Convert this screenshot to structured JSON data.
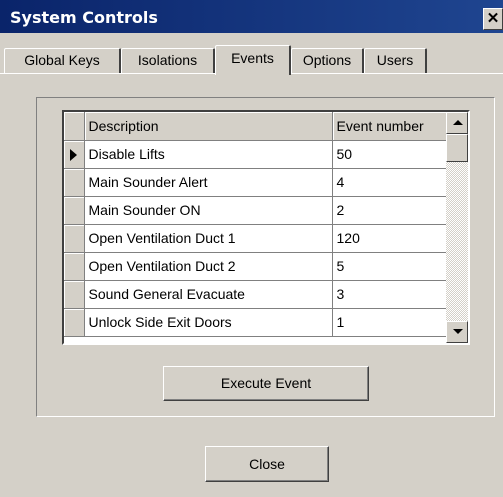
{
  "window": {
    "title": "System Controls",
    "close_glyph": "✕"
  },
  "tabs": [
    {
      "label": "Global Keys"
    },
    {
      "label": "Isolations"
    },
    {
      "label": "Events"
    },
    {
      "label": "Options"
    },
    {
      "label": "Users"
    }
  ],
  "active_tab": "Events",
  "events_table": {
    "columns": [
      "Description",
      "Event number"
    ],
    "rows": [
      {
        "description": "Disable Lifts",
        "event_number": "50",
        "selected": true
      },
      {
        "description": "Main Sounder Alert",
        "event_number": "4"
      },
      {
        "description": "Main Sounder ON",
        "event_number": "2"
      },
      {
        "description": "Open Ventilation Duct 1",
        "event_number": "120"
      },
      {
        "description": "Open Ventilation Duct 2",
        "event_number": "5"
      },
      {
        "description": "Sound General Evacuate",
        "event_number": "3"
      },
      {
        "description": "Unlock Side Exit Doors",
        "event_number": "1"
      }
    ]
  },
  "buttons": {
    "execute": "Execute Event",
    "close": "Close"
  }
}
